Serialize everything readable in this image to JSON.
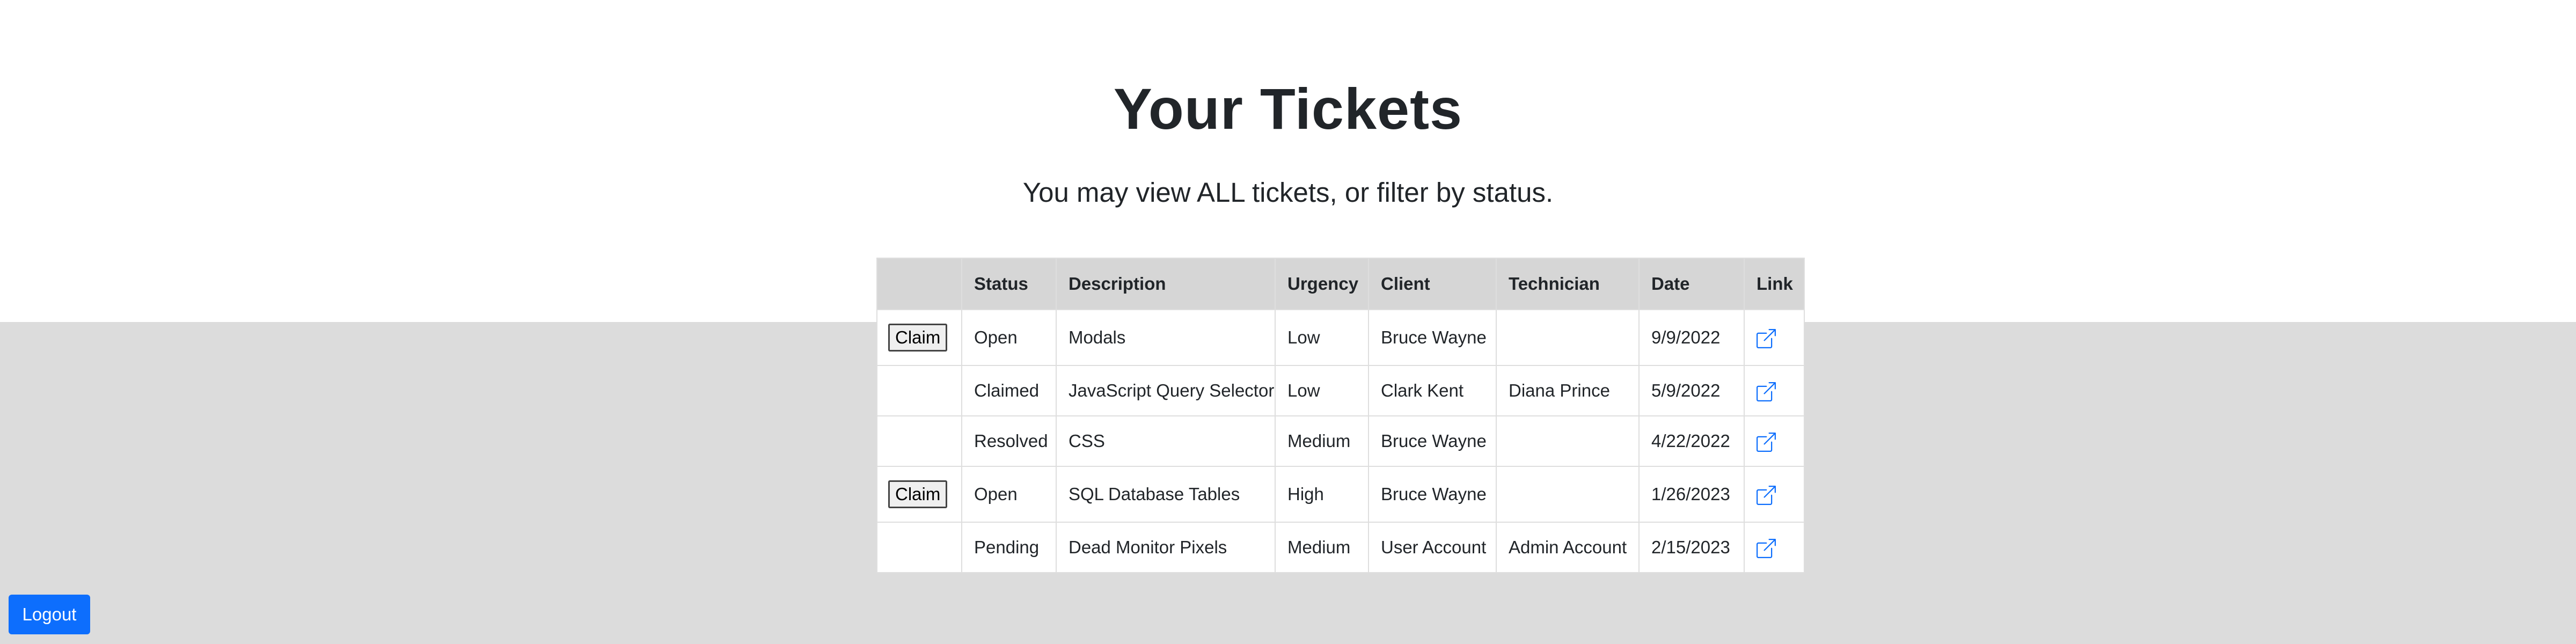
{
  "page": {
    "title": "Your Tickets",
    "subtitle": "You may view ALL tickets, or filter by status."
  },
  "table": {
    "headers": [
      "",
      "Status",
      "Description",
      "Urgency",
      "Client",
      "Technician",
      "Date",
      "Link"
    ],
    "rows": [
      {
        "action": "Claim",
        "status": "Open",
        "description": "Modals",
        "urgency": "Low",
        "client": "Bruce Wayne",
        "technician": "",
        "date": "9/9/2022",
        "link_icon": "external-link-icon"
      },
      {
        "action": "",
        "status": "Claimed",
        "description": "JavaScript Query Selector",
        "urgency": "Low",
        "client": "Clark Kent",
        "technician": "Diana Prince",
        "date": "5/9/2022",
        "link_icon": "external-link-icon"
      },
      {
        "action": "",
        "status": "Resolved",
        "description": "CSS",
        "urgency": "Medium",
        "client": "Bruce Wayne",
        "technician": "",
        "date": "4/22/2022",
        "link_icon": "external-link-icon"
      },
      {
        "action": "Claim",
        "status": "Open",
        "description": "SQL Database Tables",
        "urgency": "High",
        "client": "Bruce Wayne",
        "technician": "",
        "date": "1/26/2023",
        "link_icon": "external-link-icon"
      },
      {
        "action": "",
        "status": "Pending",
        "description": "Dead Monitor Pixels",
        "urgency": "Medium",
        "client": "User Account",
        "technician": "Admin Account",
        "date": "2/15/2023",
        "link_icon": "external-link-icon"
      }
    ]
  },
  "footer": {
    "logout_label": "Logout"
  },
  "colors": {
    "accent": "#0d6efd",
    "link": "#0d6efd",
    "background": "#dcdcdc",
    "header_bg": "#d6d6d6"
  }
}
